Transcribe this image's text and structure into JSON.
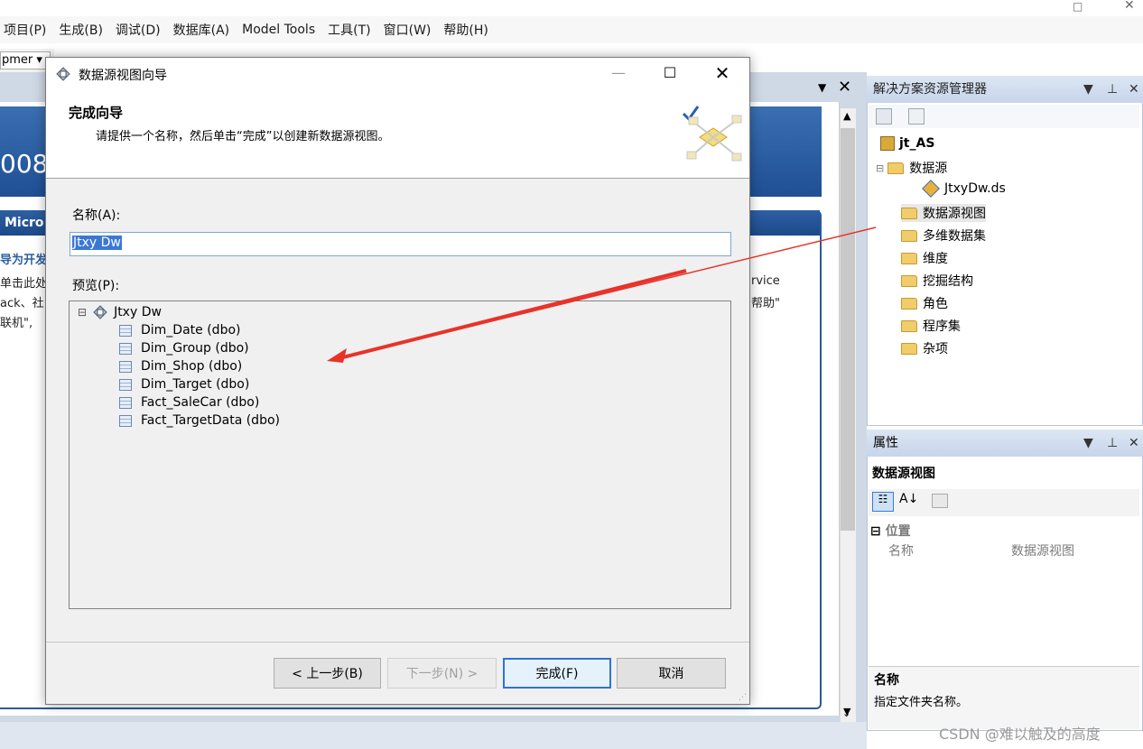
{
  "menubar": {
    "items": [
      "项目(P)",
      "生成(B)",
      "调试(D)",
      "数据库(A)",
      "Model Tools",
      "工具(T)",
      "窗口(W)",
      "帮助(H)"
    ]
  },
  "toolbar": {
    "config_combo": "pmer"
  },
  "start_page": {
    "banner_year": "008",
    "header_fragment": "Micro",
    "left_lines": [
      "导为开发",
      "单击此处",
      "ack、社",
      "联机\","
    ],
    "right_lines": [
      "rvice",
      "帮助\""
    ]
  },
  "solution_explorer": {
    "title": "解决方案资源管理器",
    "project": "jt_AS",
    "tree": [
      {
        "label": "数据源",
        "type": "folder"
      },
      {
        "label": "JtxyDw.ds",
        "type": "datasource"
      },
      {
        "label": "数据源视图",
        "type": "folder"
      },
      {
        "label": "多维数据集",
        "type": "folder"
      },
      {
        "label": "维度",
        "type": "folder"
      },
      {
        "label": "挖掘结构",
        "type": "folder"
      },
      {
        "label": "角色",
        "type": "folder"
      },
      {
        "label": "程序集",
        "type": "folder"
      },
      {
        "label": "杂项",
        "type": "folder"
      }
    ]
  },
  "properties": {
    "title": "属性",
    "object_name": "数据源视图",
    "category": "位置",
    "row_name": "名称",
    "row_value": "数据源视图",
    "desc_title": "名称",
    "desc_text": "指定文件夹名称。"
  },
  "dialog": {
    "title": "数据源视图向导",
    "heading": "完成向导",
    "instruction": "请提供一个名称，然后单击“完成”以创建新数据源视图。",
    "name_label": "名称(A):",
    "name_value": "Jtxy Dw",
    "preview_label": "预览(P):",
    "preview_root": "Jtxy Dw",
    "preview_tables": [
      "Dim_Date (dbo)",
      "Dim_Group (dbo)",
      "Dim_Shop (dbo)",
      "Dim_Target (dbo)",
      "Fact_SaleCar (dbo)",
      "Fact_TargetData (dbo)"
    ],
    "buttons": {
      "back": "< 上一步(B)",
      "next": "下一步(N) >",
      "finish": "完成(F)",
      "cancel": "取消"
    }
  },
  "watermark": "CSDN @难以触及的高度",
  "colors": {
    "accent_blue": "#2f73d0",
    "arrow_red": "#e8332a",
    "banner_blue": "#2d5fa3"
  }
}
